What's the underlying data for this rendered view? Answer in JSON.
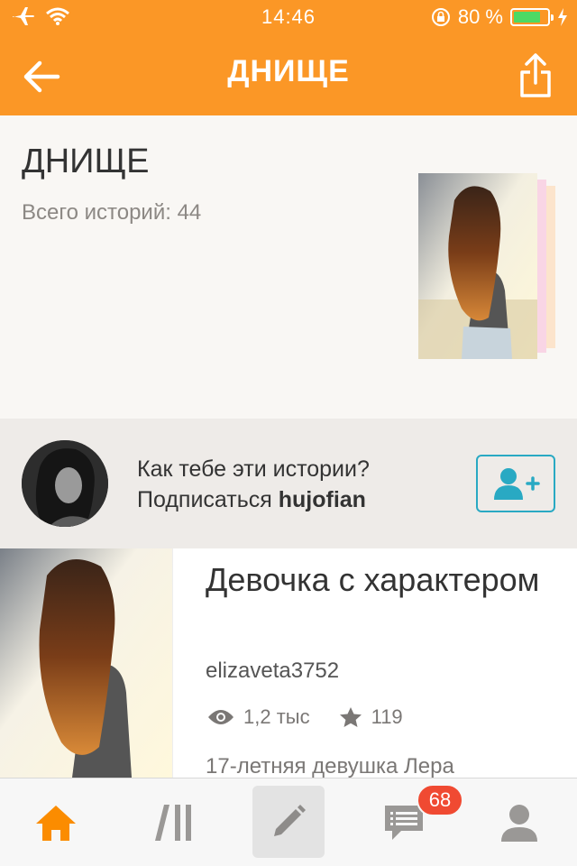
{
  "status_bar": {
    "time": "14:46",
    "battery_percent": "80 %",
    "battery_level": 0.8
  },
  "header": {
    "title": "ДНИЩЕ",
    "back_icon": "arrow-left-icon",
    "share_icon": "share-icon",
    "color": "#fb9726"
  },
  "collection": {
    "title": "ДНИЩЕ",
    "count_label": "Всего историй: 44"
  },
  "subscribe": {
    "question": "Как тебе эти истории?",
    "prefix": "Подписаться",
    "username": "hujofian",
    "button_icon": "add-user-icon",
    "accent": "#29a9c3"
  },
  "story": {
    "title": "Девочка с характером",
    "author": "elizaveta3752",
    "views": "1,2 тыс",
    "stars": "119",
    "description": "17-летняя девушка Лера"
  },
  "tabbar": {
    "items": [
      "home-icon",
      "library-icon",
      "write-icon",
      "messages-icon",
      "profile-icon"
    ],
    "messages_badge": "68",
    "active_color": "#fb8c00"
  }
}
